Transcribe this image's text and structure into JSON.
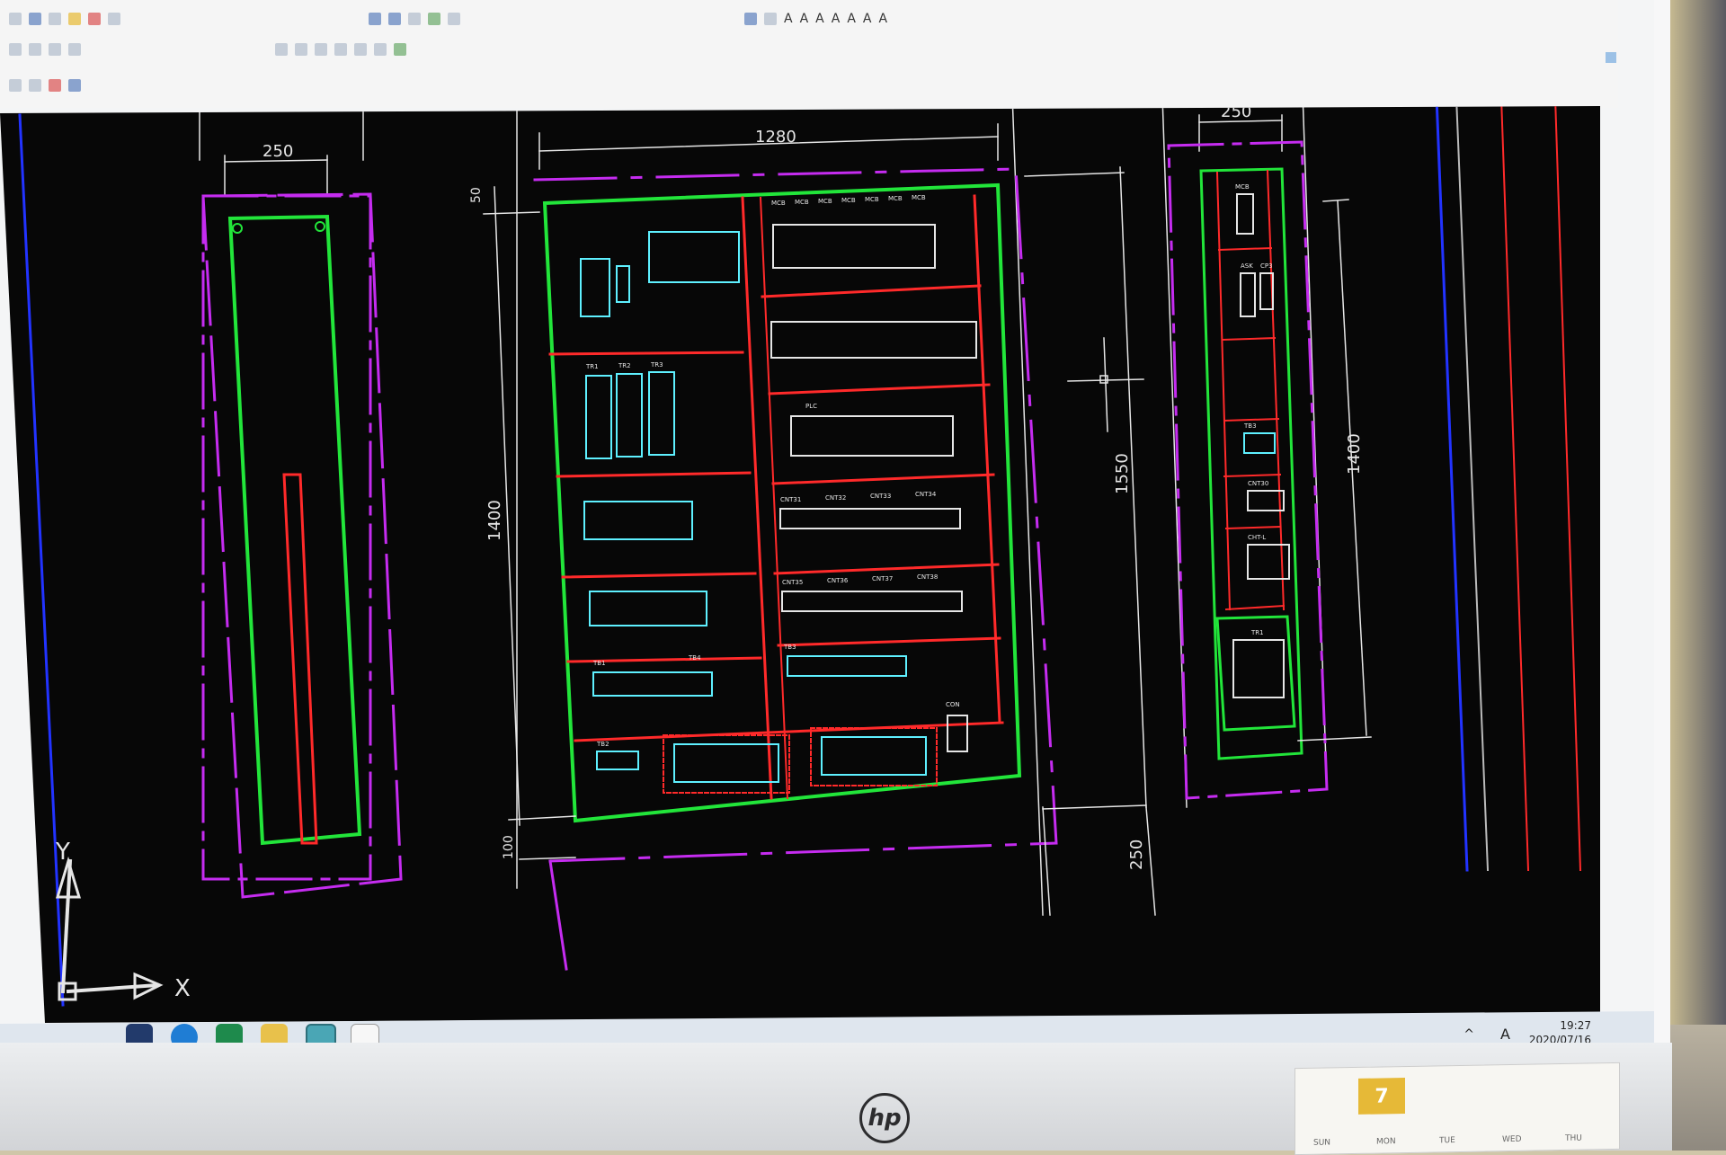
{
  "colors": {
    "screen_bg": "#070707",
    "green": "#22e53a",
    "red": "#ff2a2a",
    "magenta": "#c52cf0",
    "cyan": "#5ef0ff",
    "white": "#e6e6e6",
    "blue": "#2233ff"
  },
  "toolbar": {
    "icons": [
      "new-icon",
      "open-icon",
      "save-icon",
      "print-icon",
      "undo-icon",
      "redo-icon",
      "zoom-in-icon",
      "zoom-out-icon",
      "pan-icon",
      "text-style-icon"
    ],
    "text_buttons": [
      "A",
      "A",
      "A",
      "A",
      "A",
      "A",
      "A"
    ]
  },
  "drawing": {
    "left_panel": {
      "width_dim": "250"
    },
    "main_panel": {
      "width_dim": "1280",
      "height_dim": "1400",
      "top_offset_dim": "50",
      "bottom_offset_dim": "100",
      "labels": {
        "breakers": [
          "MCB",
          "MCB",
          "MCB",
          "MCB",
          "MCB",
          "MCB",
          "MCB"
        ],
        "transformers": [
          "TR1",
          "TR2",
          "TR3"
        ],
        "plc": "PLC",
        "terminals": [
          "TB1",
          "TB2",
          "TB3",
          "TB4"
        ],
        "connectors": [
          "CNT31",
          "CNT32",
          "CNT33",
          "CNT34",
          "CNT35",
          "CNT36",
          "CNT37",
          "CNT38"
        ],
        "con": "CON"
      }
    },
    "right_dims": {
      "total_height": "1550",
      "bottom": "250"
    },
    "side_panel": {
      "width_dim": "250",
      "height_dim": "1400",
      "labels": [
        "MCB",
        "ASK",
        "CP3",
        "TB3",
        "CNT30",
        "CHT-L",
        "TR1"
      ]
    },
    "axis": {
      "y_label": "Y",
      "x_label": "X"
    }
  },
  "taskbar": {
    "apps": [
      "start-button",
      "edge-icon",
      "excel-icon",
      "file-explorer-icon",
      "cad-app-icon",
      "notes-icon"
    ],
    "clock_time": "19:27",
    "clock_date": "2020/07/16",
    "lang": "A"
  },
  "monitor": {
    "brand": "hp"
  },
  "calendar": {
    "month_badge": "7",
    "day_headers": [
      "SUN",
      "MON",
      "TUE",
      "WED",
      "THU"
    ]
  }
}
